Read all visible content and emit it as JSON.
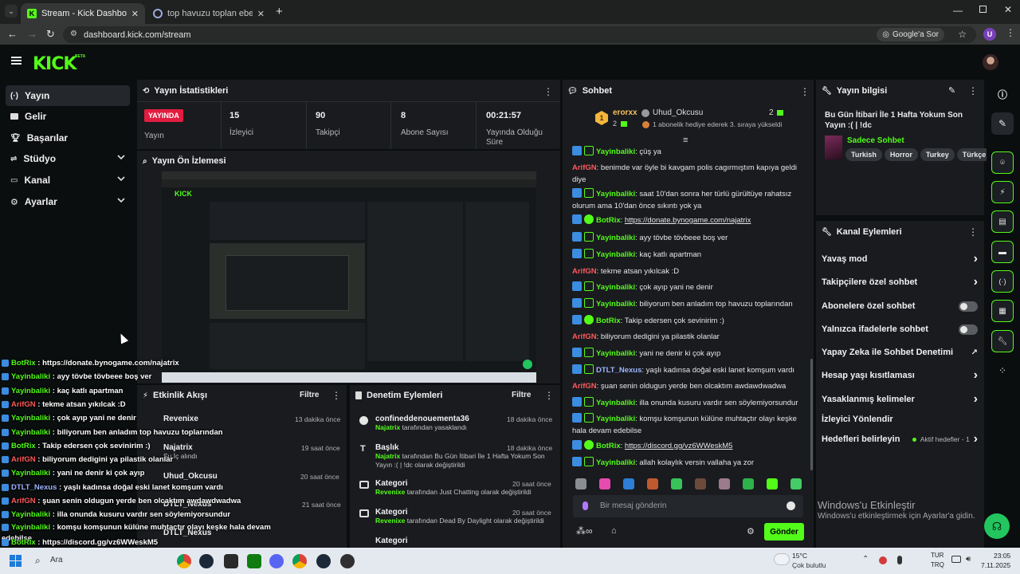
{
  "browser": {
    "tabs": [
      {
        "label": "Stream - Kick Dashboard",
        "icon": "kick-favicon-icon",
        "active": true
      },
      {
        "label": "top havuzu toplan ebebek - Go",
        "icon": "google-favicon-icon",
        "active": false
      }
    ],
    "url": "dashboard.kick.com/stream",
    "google_lens_label": "Google'a Sor",
    "profile_initial": "U"
  },
  "app": {
    "logo": "KICK",
    "logo_tag": "BETA",
    "brand_color": "#53fc18"
  },
  "nav": {
    "items": [
      {
        "label": "Yayın",
        "icon": "broadcast-icon",
        "selected": true
      },
      {
        "label": "Gelir",
        "icon": "money-icon"
      },
      {
        "label": "Başarılar",
        "icon": "trophy-icon"
      },
      {
        "label": "Stüdyo",
        "icon": "studio-icon",
        "expandable": true
      },
      {
        "label": "Kanal",
        "icon": "channel-icon",
        "expandable": true
      },
      {
        "label": "Ayarlar",
        "icon": "gear-icon",
        "expandable": true
      }
    ]
  },
  "stats": {
    "title": "Yayın İstatistikleri",
    "live_badge": "YAYINDA",
    "items": [
      {
        "value": "",
        "label": "Yayın"
      },
      {
        "value": "15",
        "label": "İzleyici"
      },
      {
        "value": "90",
        "label": "Takipçi"
      },
      {
        "value": "8",
        "label": "Abone Sayısı"
      },
      {
        "value": "00:21:57",
        "label": "Yayında Olduğu Süre"
      }
    ]
  },
  "preview": {
    "title": "Yayın Ön İzlemesi"
  },
  "activity": {
    "title": "Etkinlik Akışı",
    "filter": "Filtre",
    "items": [
      {
        "name": "Revenixe",
        "sub": "",
        "time": "13 dakika önce"
      },
      {
        "name": "Najatrix",
        "sub": "Su İç alındı",
        "time": "19 saat önce"
      },
      {
        "name": "Uhud_Okcusu",
        "sub": "",
        "time": "20 saat önce"
      },
      {
        "name": "DTLT_Nexus",
        "sub": "",
        "time": "21 saat önce"
      },
      {
        "name": "DTLT_Nexus",
        "sub": "",
        "time": ""
      }
    ]
  },
  "moderation": {
    "title": "Denetim Eylemleri",
    "filter": "Filtre",
    "items": [
      {
        "title": "confineddenouementa36",
        "actor": "Najatrix",
        "desc": "tarafından yasaklandı",
        "time": "18 dakika önce"
      },
      {
        "title": "Başlık",
        "actor": "Najatrix",
        "desc": "tarafından Bu Gün İtibari İle 1 Hafta Yokum Son Yayın :( | !dc olarak değiştirildi",
        "time": "18 dakika önce"
      },
      {
        "title": "Kategori",
        "actor": "Revenixe",
        "desc": "tarafından Just Chatting olarak değiştirildi",
        "time": "20 saat önce"
      },
      {
        "title": "Kategori",
        "actor": "Revenixe",
        "desc": "tarafından Dead By Daylight olarak değiştirildi",
        "time": "20 saat önce"
      },
      {
        "title": "Kategori",
        "actor": "",
        "desc": "",
        "time": ""
      }
    ]
  },
  "chat": {
    "title": "Sohbet",
    "top_gifter": {
      "rank": "1",
      "name": "erorxx",
      "count": "2"
    },
    "gift_user": "Uhud_Okcusu",
    "gift_count": "2",
    "gift_note": "1 abonelik hediye ederek 3. sıraya yükseldi",
    "messages": [
      {
        "user": "Yayinbaliki",
        "color": "#53fc18",
        "badges": "mod",
        "text": "çüş ya"
      },
      {
        "user": "ArifGN",
        "color": "#ff5a5a",
        "badges": "",
        "text": "benimde var öyle bi kavgam polis cagırmıştım kapıya geldi diye"
      },
      {
        "user": "Yayinbaliki",
        "color": "#53fc18",
        "badges": "mod",
        "text": "saat 10'dan sonra her türlü gürültüye rahatsız olurum ama 10'dan önce sıkıntı yok ya"
      },
      {
        "user": "BotRix",
        "color": "#53fc18",
        "badges": "bot",
        "text": "https://donate.bynogame.com/najatrix"
      },
      {
        "user": "Yayinbaliki",
        "color": "#53fc18",
        "badges": "mod",
        "text": "ayy tövbe tövbeee boş ver"
      },
      {
        "user": "Yayinbaliki",
        "color": "#53fc18",
        "badges": "mod",
        "text": "kaç katlı apartman"
      },
      {
        "user": "ArifGN",
        "color": "#ff5a5a",
        "badges": "",
        "text": "tekme atsan yıkılcak :D"
      },
      {
        "user": "Yayinbaliki",
        "color": "#53fc18",
        "badges": "mod",
        "text": "çok ayıp yani ne denir"
      },
      {
        "user": "Yayinbaliki",
        "color": "#53fc18",
        "badges": "mod",
        "text": "biliyorum ben anladım top havuzu toplarından"
      },
      {
        "user": "BotRix",
        "color": "#53fc18",
        "badges": "bot",
        "text": "Takip edersen çok sevinirim :)"
      },
      {
        "user": "ArifGN",
        "color": "#ff5a5a",
        "badges": "",
        "text": "biliyorum dedigini ya pilastik olanlar"
      },
      {
        "user": "Yayinbaliki",
        "color": "#53fc18",
        "badges": "mod",
        "text": "yani ne denir ki çok ayıp"
      },
      {
        "user": "DTLT_Nexus",
        "color": "#9db4ff",
        "badges": "mod",
        "text": "yaşlı kadınsa doğal eski lanet komşum vardı"
      },
      {
        "user": "ArifGN",
        "color": "#ff5a5a",
        "badges": "",
        "text": "şuan senin oldugun yerde ben olcaktım awdawdwadwa"
      },
      {
        "user": "Yayinbaliki",
        "color": "#53fc18",
        "badges": "mod",
        "text": "illa onunda kusuru vardır sen söylemiyorsundur"
      },
      {
        "user": "Yayinbaliki",
        "color": "#53fc18",
        "badges": "mod",
        "text": "komşu komşunun külüne muhtaçtır olayı keşke hala devam edebilse"
      },
      {
        "user": "BotRix",
        "color": "#53fc18",
        "badges": "bot",
        "text": "https://discord.gg/vz6WWeskM5"
      },
      {
        "user": "Yayinbaliki",
        "color": "#53fc18",
        "badges": "mod",
        "text": "allah kolaylık versin vallaha ya zor"
      }
    ],
    "input_placeholder": "Bir mesaj gönderin",
    "send_label": "Gönder"
  },
  "overlay_chat": [
    {
      "user": "BotRix",
      "color": "#53fc18",
      "text": "https://donate.bynogame.com/najatrix"
    },
    {
      "user": "Yayinbaliki",
      "color": "#53fc18",
      "text": "ayy tövbe tövbeee boş ver"
    },
    {
      "user": "Yayinbaliki",
      "color": "#53fc18",
      "text": "kaç katlı apartman"
    },
    {
      "user": "ArifGN",
      "color": "#ff5a5a",
      "text": "tekme atsan yıkılcak :D"
    },
    {
      "user": "Yayinbaliki",
      "color": "#53fc18",
      "text": "çok ayıp yani ne denir"
    },
    {
      "user": "Yayinbaliki",
      "color": "#53fc18",
      "text": "biliyorum ben anladım top havuzu toplarından"
    },
    {
      "user": "BotRix",
      "color": "#53fc18",
      "text": "Takip edersen çok sevinirim :)"
    },
    {
      "user": "ArifGN",
      "color": "#ff5a5a",
      "text": "biliyorum dedigini ya pilastik olanlar"
    },
    {
      "user": "Yayinbaliki",
      "color": "#53fc18",
      "text": "yani ne denir ki çok ayıp"
    },
    {
      "user": "DTLT_Nexus",
      "color": "#9db4ff",
      "text": "yaşlı kadınsa doğal eski lanet komşum vardı"
    },
    {
      "user": "ArifGN",
      "color": "#ff5a5a",
      "text": "şuan senin oldugun yerde ben olcaktım awdawdwadwa"
    },
    {
      "user": "Yayinbaliki",
      "color": "#53fc18",
      "text": "illa onunda kusuru vardır sen söylemiyorsundur"
    },
    {
      "user": "Yayinbaliki",
      "color": "#53fc18",
      "text": "komşu komşunun külüne muhtaçtır olayı keşke hala devam edebilse"
    },
    {
      "user": "BotRix",
      "color": "#53fc18",
      "text": "https://discord.gg/vz6WWeskM5"
    },
    {
      "user": "Yayinbaliki",
      "color": "#53fc18",
      "text": "allah kolaylık versin vallaha ya zor"
    }
  ],
  "stream_info": {
    "title_label": "Yayın bilgisi",
    "stream_title": "Bu Gün İtibari İle 1 Hafta Yokum Son Yayın :( | !dc",
    "category": "Sadece Sohbet",
    "tags": [
      "Turkish",
      "Horror",
      "Turkey",
      "Türkçe"
    ]
  },
  "channel_actions": {
    "title": "Kanal Eylemleri",
    "items": [
      {
        "label": "Yavaş mod",
        "control": "chevron"
      },
      {
        "label": "Takipçilere özel sohbet",
        "control": "chevron"
      },
      {
        "label": "Abonelere özel sohbet",
        "control": "toggle"
      },
      {
        "label": "Yalnızca ifadelerle sohbet",
        "control": "toggle"
      },
      {
        "label": "Yapay Zeka ile Sohbet Denetimi",
        "control": "external"
      },
      {
        "label": "Hesap yaşı kısıtlaması",
        "control": "chevron"
      },
      {
        "label": "Yasaklanmış kelimeler",
        "control": "chevron"
      },
      {
        "label": "İzleyici Yönlendir",
        "control": "none"
      },
      {
        "label": "Hedefleri belirleyin",
        "control": "chevron",
        "extra": "Aktif hedefler - 1"
      }
    ]
  },
  "watermark": {
    "title": "Windows'u Etkinleştir",
    "sub": "Windows'u etkinleştirmek için Ayarlar'a gidin."
  },
  "taskbar": {
    "search": "Ara",
    "weather_temp": "15°C",
    "weather_desc": "Çok bulutlu",
    "lang": "TUR",
    "lang2": "TRQ",
    "time": "23:05",
    "date": "7.11.2025"
  }
}
